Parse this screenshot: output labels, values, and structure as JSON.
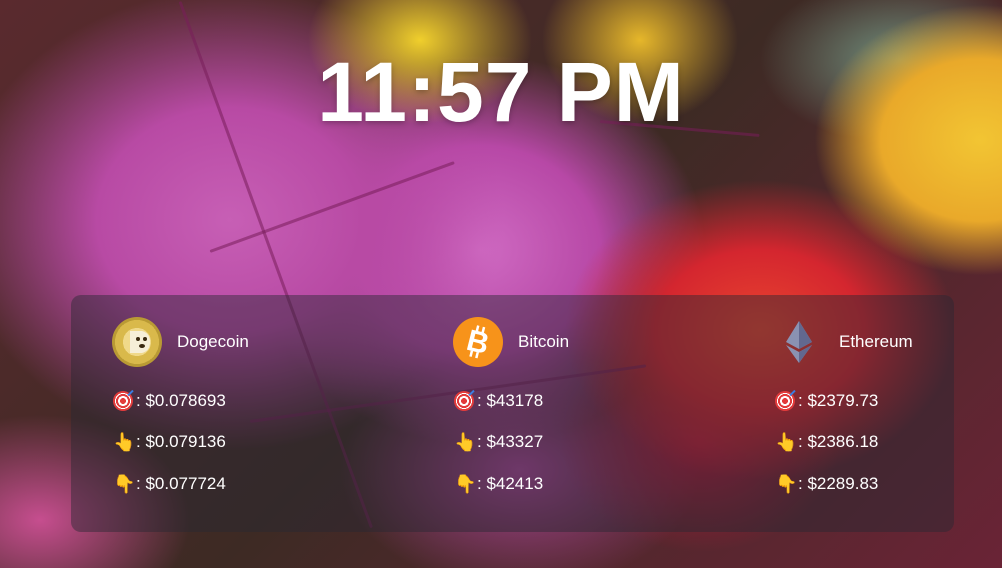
{
  "clock": {
    "time": "11:57 PM"
  },
  "coins": [
    {
      "name": "Dogecoin",
      "icon": "dogecoin-logo-icon",
      "current": ": $0.078693",
      "high": ": $0.079136",
      "low": ": $0.077724"
    },
    {
      "name": "Bitcoin",
      "icon": "bitcoin-logo-icon",
      "current": ": $43178",
      "high": ": $43327",
      "low": ": $42413"
    },
    {
      "name": "Ethereum",
      "icon": "ethereum-logo-icon",
      "current": ": $2379.73",
      "high": ": $2386.18",
      "low": ": $2289.83"
    }
  ],
  "row_icons": {
    "current": "target-icon",
    "high": "pointing-up-icon",
    "low": "pointing-down-icon"
  },
  "colors": {
    "panel": "#28283273",
    "text": "#ffffff",
    "bitcoin": "#f7931a",
    "dogecoin": "#c2a633",
    "ethereum": "#627eea"
  }
}
